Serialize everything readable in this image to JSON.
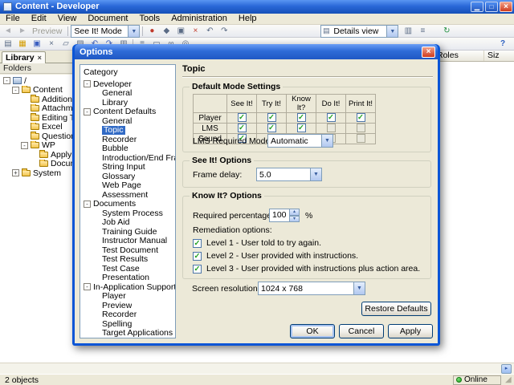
{
  "window": {
    "title": "Content - Developer",
    "menus": [
      "File",
      "Edit",
      "View",
      "Document",
      "Tools",
      "Administration",
      "Help"
    ],
    "toolbar1": {
      "left_icons": [
        {
          "name": "back-icon",
          "glyph": "◄",
          "disabled": true
        },
        {
          "name": "forward-icon",
          "glyph": "►",
          "disabled": true
        }
      ],
      "preview_label": "Preview",
      "mode_combo": "See It! Mode",
      "mid_icons": [
        {
          "name": "record-topic-icon",
          "glyph": "●",
          "color": "#c0392b"
        },
        {
          "name": "sound-editor-icon",
          "glyph": "◆",
          "color": "#5a6b85"
        },
        {
          "name": "bubble-icon",
          "glyph": "▣",
          "color": "#5a6b85"
        },
        {
          "name": "delete-icon",
          "glyph": "×",
          "color": "#c0392b"
        },
        {
          "name": "undo-icon",
          "glyph": "↶",
          "color": "#5a6b85"
        },
        {
          "name": "redo-icon",
          "glyph": "↷",
          "color": "#5a6b85"
        }
      ],
      "view_combo": "Details view",
      "right_icons": [
        {
          "name": "view-options-icon",
          "glyph": "▥",
          "color": "#5a6b85"
        },
        {
          "name": "sort-icon",
          "glyph": "≡",
          "color": "#5a6b85"
        }
      ],
      "refresh_icon": {
        "name": "refresh-icon",
        "glyph": "↻",
        "color": "#1e8e3e"
      }
    },
    "toolbar2": {
      "icons_a": [
        {
          "name": "new-icon",
          "glyph": "▤",
          "color": "#5a6b85"
        },
        {
          "name": "open-icon",
          "glyph": "▦",
          "color": "#d39c00"
        },
        {
          "name": "save-icon",
          "glyph": "▣",
          "color": "#3b5fc0"
        },
        {
          "name": "cut-icon",
          "glyph": "×",
          "color": "#5a6b85"
        },
        {
          "name": "copy-icon",
          "glyph": "▱",
          "color": "#5a6b85"
        },
        {
          "name": "paste-icon",
          "glyph": "▨",
          "color": "#5a6b85"
        },
        {
          "name": "undo-icon",
          "glyph": "↶",
          "color": "#3b5fc0"
        },
        {
          "name": "redo-icon",
          "glyph": "↷",
          "color": "#3b5fc0"
        },
        {
          "name": "print-icon",
          "glyph": "▥",
          "color": "#5a6b85"
        }
      ],
      "icons_b": [
        {
          "name": "properties-icon",
          "glyph": "≡",
          "color": "#5a6b85"
        },
        {
          "name": "document-preview-icon",
          "glyph": "▭",
          "color": "#5a6b85"
        },
        {
          "name": "link-icon",
          "glyph": "∞",
          "color": "#5a6b85"
        },
        {
          "name": "attachment-icon",
          "glyph": "◎",
          "color": "#5a6b85"
        }
      ],
      "help_icon": {
        "name": "help-icon",
        "glyph": "?",
        "color": "#2b5fc0"
      }
    },
    "library_tab": "Library",
    "folders_label": "Folders",
    "tree": [
      {
        "label": "/",
        "indent": 0,
        "expander": "-",
        "icon": "root"
      },
      {
        "label": "Content",
        "indent": 1,
        "expander": "-",
        "icon": "folder"
      },
      {
        "label": "Additional To",
        "indent": 2,
        "expander": "",
        "icon": "folder"
      },
      {
        "label": "Attachments",
        "indent": 2,
        "expander": "",
        "icon": "folder"
      },
      {
        "label": "Editing Techn",
        "indent": 2,
        "expander": "",
        "icon": "folder"
      },
      {
        "label": "Excel",
        "indent": 2,
        "expander": "",
        "icon": "folder"
      },
      {
        "label": "Questions an",
        "indent": 2,
        "expander": "",
        "icon": "folder"
      },
      {
        "label": "WP",
        "indent": 2,
        "expander": "-",
        "icon": "folder"
      },
      {
        "label": "Applying F",
        "indent": 3,
        "expander": "",
        "icon": "folder"
      },
      {
        "label": "Documen",
        "indent": 3,
        "expander": "",
        "icon": "folder"
      },
      {
        "label": "System",
        "indent": 1,
        "expander": "+",
        "icon": "folder"
      }
    ],
    "list_columns": [
      "Roles",
      "Siz"
    ],
    "status": {
      "left": "2 objects",
      "right": "Online"
    }
  },
  "dialog": {
    "title": "Options",
    "category": {
      "label": "Category",
      "items": [
        {
          "label": "Developer",
          "indent": 0,
          "expander": "-"
        },
        {
          "label": "General",
          "indent": 1,
          "expander": ""
        },
        {
          "label": "Library",
          "indent": 1,
          "expander": ""
        },
        {
          "label": "Content Defaults",
          "indent": 0,
          "expander": "-"
        },
        {
          "label": "General",
          "indent": 1,
          "expander": ""
        },
        {
          "label": "Topic",
          "indent": 1,
          "expander": "",
          "selected": true
        },
        {
          "label": "Recorder",
          "indent": 1,
          "expander": ""
        },
        {
          "label": "Bubble",
          "indent": 1,
          "expander": ""
        },
        {
          "label": "Introduction/End Frame",
          "indent": 1,
          "expander": ""
        },
        {
          "label": "String Input",
          "indent": 1,
          "expander": ""
        },
        {
          "label": "Glossary",
          "indent": 1,
          "expander": ""
        },
        {
          "label": "Web Page",
          "indent": 1,
          "expander": ""
        },
        {
          "label": "Assessment",
          "indent": 1,
          "expander": ""
        },
        {
          "label": "Documents",
          "indent": 0,
          "expander": "-"
        },
        {
          "label": "System Process",
          "indent": 1,
          "expander": ""
        },
        {
          "label": "Job Aid",
          "indent": 1,
          "expander": ""
        },
        {
          "label": "Training Guide",
          "indent": 1,
          "expander": ""
        },
        {
          "label": "Instructor Manual",
          "indent": 1,
          "expander": ""
        },
        {
          "label": "Test Document",
          "indent": 1,
          "expander": ""
        },
        {
          "label": "Test Results",
          "indent": 1,
          "expander": ""
        },
        {
          "label": "Test Case",
          "indent": 1,
          "expander": ""
        },
        {
          "label": "Presentation",
          "indent": 1,
          "expander": ""
        },
        {
          "label": "In-Application Support",
          "indent": 0,
          "expander": "-"
        },
        {
          "label": "Player",
          "indent": 1,
          "expander": ""
        },
        {
          "label": "Preview",
          "indent": 1,
          "expander": ""
        },
        {
          "label": "Recorder",
          "indent": 1,
          "expander": ""
        },
        {
          "label": "Spelling",
          "indent": 1,
          "expander": ""
        },
        {
          "label": "Target Applications",
          "indent": 1,
          "expander": ""
        }
      ]
    },
    "page_title": "Topic",
    "default_mode": {
      "label": "Default Mode Settings",
      "columns": [
        "See It!",
        "Try It!",
        "Know It?",
        "Do It!",
        "Print It!"
      ],
      "rows": [
        {
          "label": "Player",
          "checked": [
            true,
            true,
            true,
            true,
            true
          ],
          "enabled": [
            true,
            true,
            true,
            true,
            true
          ]
        },
        {
          "label": "LMS",
          "checked": [
            true,
            true,
            true,
            false,
            false
          ],
          "enabled": [
            true,
            true,
            true,
            false,
            false
          ]
        },
        {
          "label": "Sound",
          "checked": [
            true,
            true,
            false,
            false,
            false
          ],
          "enabled": [
            true,
            true,
            false,
            false,
            false
          ]
        }
      ],
      "lms_label": "LMS Required Mode:",
      "lms_value": "Automatic"
    },
    "see_it": {
      "label": "See It! Options",
      "frame_delay_label": "Frame delay:",
      "frame_delay_value": "5.0"
    },
    "know_it": {
      "label": "Know It? Options",
      "required_label": "Required percentage:",
      "required_value": "100",
      "percent": "%",
      "remediation_label": "Remediation options:",
      "levels": [
        "Level 1 - User told to try again.",
        "Level 2 - User provided with instructions.",
        "Level 3 - User provided with instructions plus action area."
      ]
    },
    "screen_resolution": {
      "label": "Screen resolution:",
      "value": "1024 x 768"
    },
    "buttons": {
      "restore": "Restore Defaults",
      "ok": "OK",
      "cancel": "Cancel",
      "apply": "Apply"
    }
  }
}
